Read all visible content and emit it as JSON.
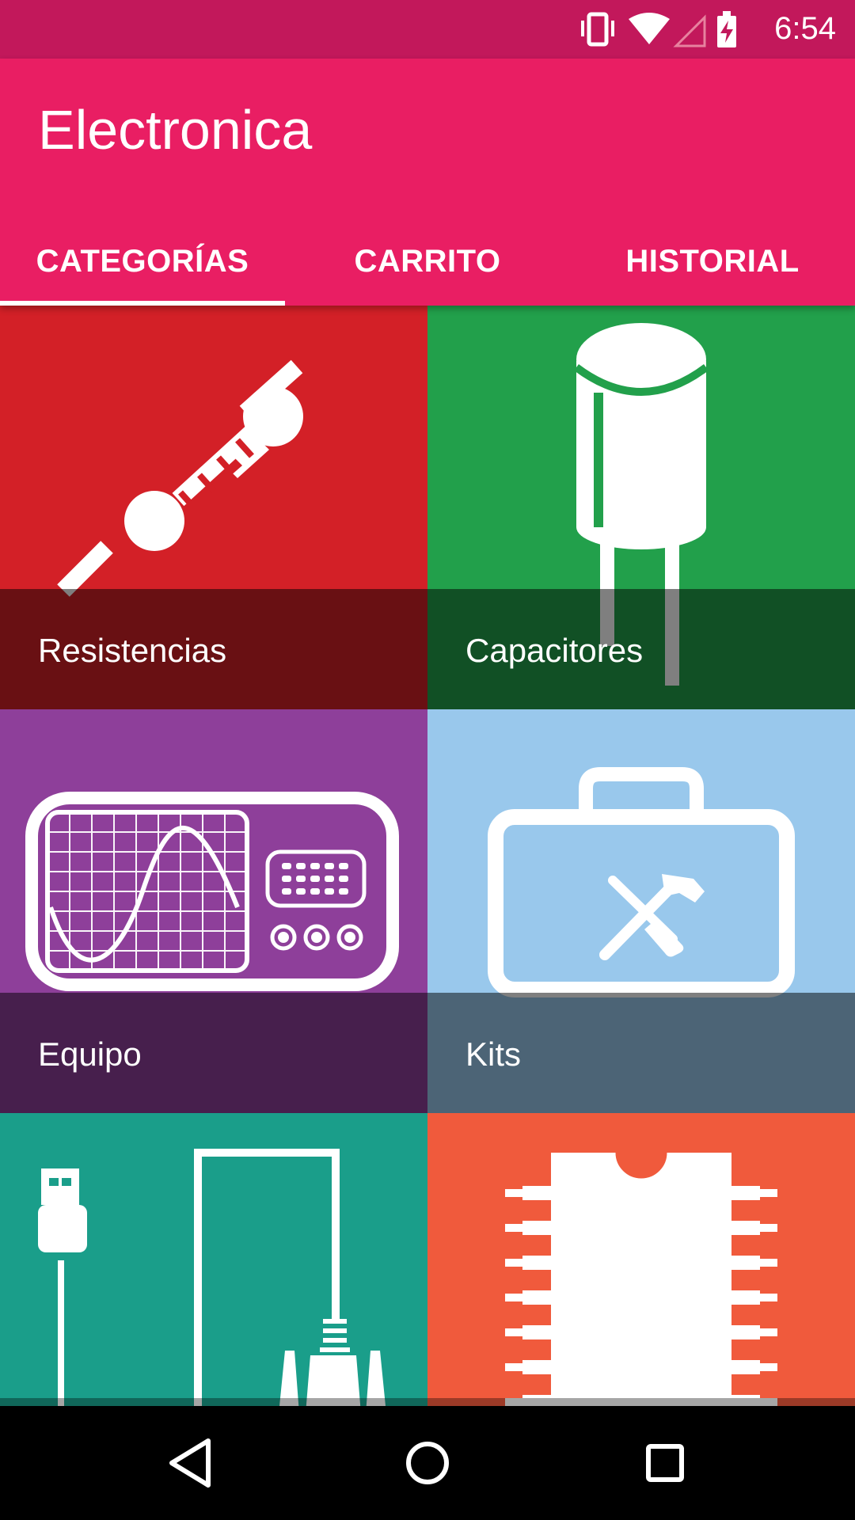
{
  "status_bar": {
    "time": "6:54"
  },
  "app_bar": {
    "title": "Electronica"
  },
  "tabs": [
    {
      "label": "CATEGORÍAS",
      "selected": true
    },
    {
      "label": "CARRITO",
      "selected": false
    },
    {
      "label": "HISTORIAL",
      "selected": false
    }
  ],
  "categories": [
    {
      "label": "Resistencias",
      "color": "#D32027",
      "icon": "resistor-icon"
    },
    {
      "label": "Capacitores",
      "color": "#22A04B",
      "icon": "capacitor-icon"
    },
    {
      "label": "Equipo",
      "color": "#8E3F9A",
      "icon": "oscilloscope-icon"
    },
    {
      "label": "Kits",
      "color": "#99C8EC",
      "icon": "toolbox-icon"
    },
    {
      "label": "",
      "color": "#1A9E8A",
      "icon": "usb-cable-icon"
    },
    {
      "label": "",
      "color": "#F05A3C",
      "icon": "chip-icon"
    }
  ],
  "colors": {
    "status_bar": "#C2185B",
    "app_bar": "#E91E63",
    "accent": "#FFFFFF"
  },
  "nav": {
    "back_icon": "back-icon",
    "home_icon": "home-icon",
    "recents_icon": "recents-icon"
  }
}
